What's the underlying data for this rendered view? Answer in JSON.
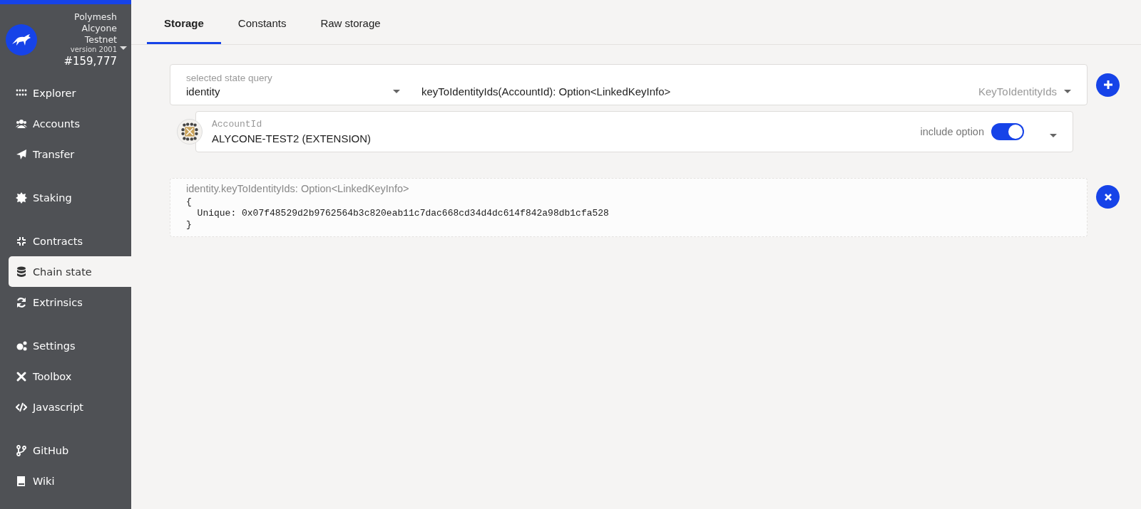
{
  "chain": {
    "name": "Polymesh Alcyone Testnet",
    "version": "version 2001",
    "block": "#159,777"
  },
  "sidebar": {
    "groups": [
      {
        "items": [
          {
            "label": "Explorer",
            "selected": false
          },
          {
            "label": "Accounts",
            "selected": false
          },
          {
            "label": "Transfer",
            "selected": false
          }
        ]
      },
      {
        "items": [
          {
            "label": "Staking",
            "selected": false
          }
        ]
      },
      {
        "items": [
          {
            "label": "Contracts",
            "selected": false
          },
          {
            "label": "Chain state",
            "selected": true
          },
          {
            "label": "Extrinsics",
            "selected": false
          }
        ]
      },
      {
        "items": [
          {
            "label": "Settings",
            "selected": false
          },
          {
            "label": "Toolbox",
            "selected": false
          },
          {
            "label": "Javascript",
            "selected": false
          }
        ]
      },
      {
        "items": [
          {
            "label": "GitHub",
            "selected": false
          },
          {
            "label": "Wiki",
            "selected": false
          }
        ]
      }
    ]
  },
  "tabs": [
    {
      "label": "Storage",
      "selected": true
    },
    {
      "label": "Constants",
      "selected": false
    },
    {
      "label": "Raw storage",
      "selected": false
    }
  ],
  "query": {
    "label": "selected state query",
    "module": "identity",
    "method": "keyToIdentityIds(AccountId): Option<LinkedKeyInfo>",
    "method_name": "KeyToIdentityIds"
  },
  "param": {
    "label": "AccountId",
    "value": "ALYCONE-TEST2 (EXTENSION)",
    "include_option_label": "include option",
    "include_option": true
  },
  "result": {
    "title": "identity.keyToIdentityIds: Option<LinkedKeyInfo>",
    "lines": [
      "{",
      "  Unique: 0x07f48529d2b9762564b3c820eab11c7dac668cd34d4dc614f842a98db1cfa528",
      "}"
    ]
  }
}
